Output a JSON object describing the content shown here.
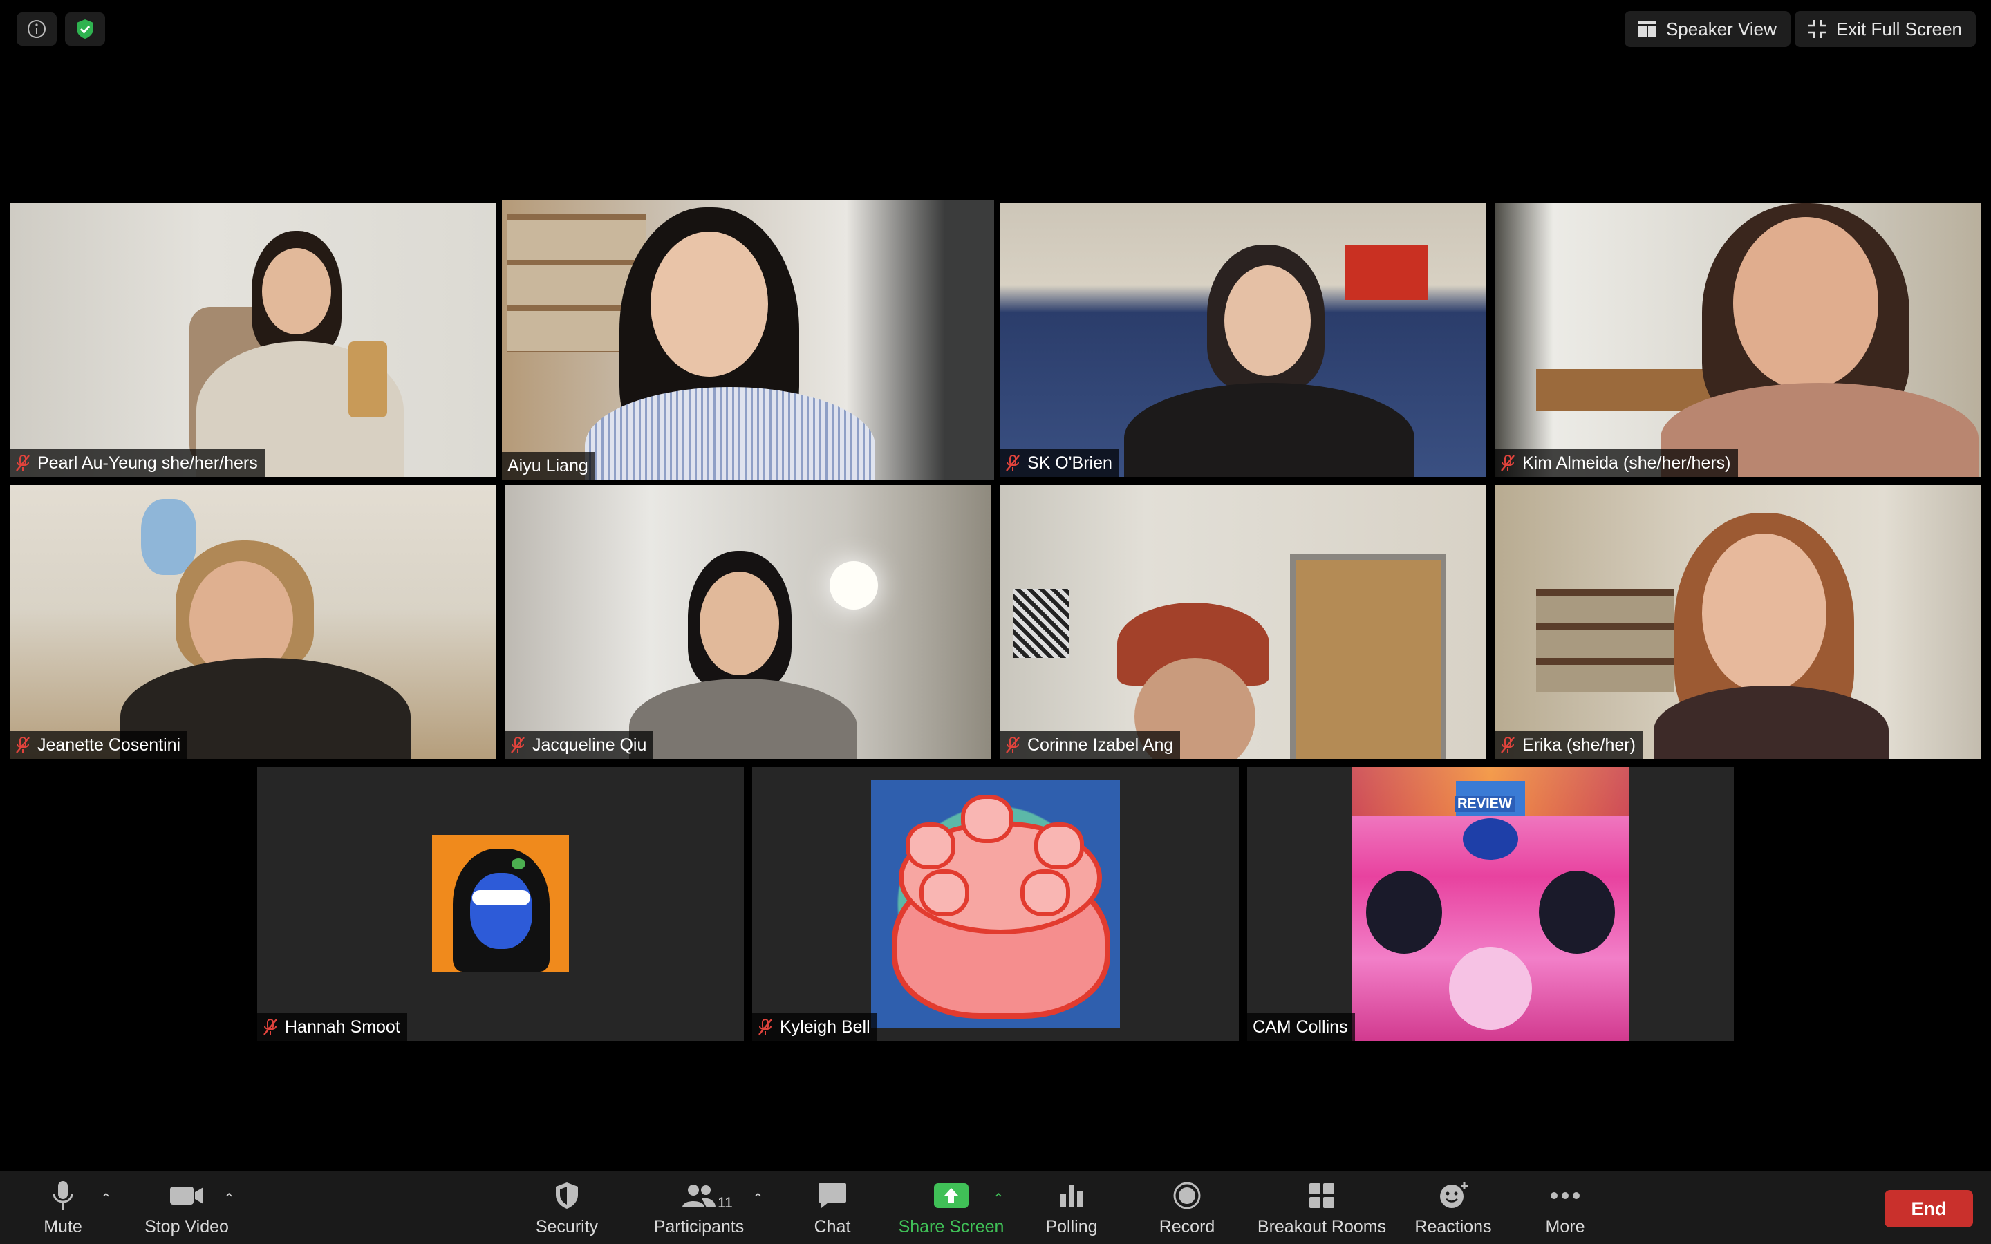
{
  "top": {
    "speaker_view": "Speaker View",
    "exit_full_screen": "Exit Full Screen"
  },
  "participants": [
    {
      "name": "Pearl Au-Yeung she/her/hers",
      "muted": true
    },
    {
      "name": "Aiyu Liang",
      "muted": false,
      "active_speaker": true
    },
    {
      "name": "SK O'Brien",
      "muted": true
    },
    {
      "name": "Kim Almeida (she/her/hers)",
      "muted": true
    },
    {
      "name": "Jeanette Cosentini",
      "muted": true
    },
    {
      "name": "Jacqueline Qiu",
      "muted": true
    },
    {
      "name": "Corinne Izabel Ang",
      "muted": true
    },
    {
      "name": "Erika (she/her)",
      "muted": true
    },
    {
      "name": "Hannah Smoot",
      "muted": true
    },
    {
      "name": "Kyleigh Bell",
      "muted": true
    },
    {
      "name": "CAM Collins",
      "muted": false
    }
  ],
  "review_image_text": "REVIEW",
  "toolbar": {
    "mute": "Mute",
    "stop_video": "Stop Video",
    "security": "Security",
    "participants": "Participants",
    "participants_count": "11",
    "chat": "Chat",
    "share_screen": "Share Screen",
    "polling": "Polling",
    "record": "Record",
    "breakout_rooms": "Breakout Rooms",
    "reactions": "Reactions",
    "more": "More",
    "end": "End"
  },
  "colors": {
    "active_speaker_border": "#c9d96e",
    "share_green": "#40c057",
    "end_red": "#c9302c",
    "muted_icon_red": "#e0433c"
  }
}
